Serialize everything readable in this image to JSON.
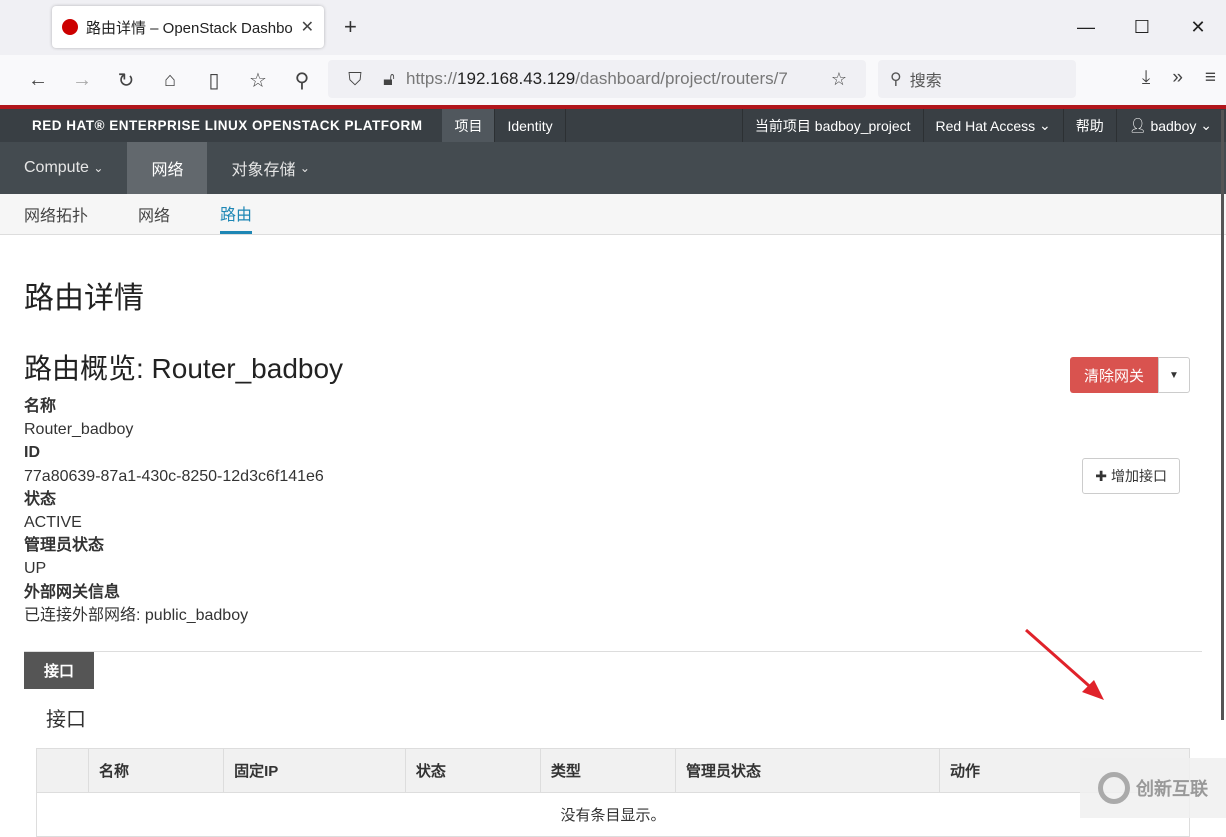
{
  "browser": {
    "tab_title": "路由详情 – OpenStack Dashbo",
    "url_host": "192.168.43.129",
    "url_prefix": "https://",
    "url_path": "/dashboard/project/routers/7",
    "search_placeholder": "搜索"
  },
  "topnav": {
    "brand": "RED HAT® ENTERPRISE LINUX OPENSTACK PLATFORM",
    "project": "项目",
    "identity": "Identity",
    "current_project": "当前项目 badboy_project",
    "redhat_access": "Red Hat Access",
    "help": "帮助",
    "user": "badboy"
  },
  "mainnav": {
    "compute": "Compute",
    "network": "网络",
    "object_storage": "对象存储"
  },
  "subnav": {
    "topology": "网络拓扑",
    "networks": "网络",
    "routers": "路由"
  },
  "page": {
    "title": "路由详情",
    "overview": "路由概览: Router_badboy",
    "clear_gateway": "清除网关",
    "details": [
      {
        "label": "名称",
        "value": "Router_badboy"
      },
      {
        "label": "ID",
        "value": "77a80639-87a1-430c-8250-12d3c6f141e6"
      },
      {
        "label": "状态",
        "value": "ACTIVE"
      },
      {
        "label": "管理员状态",
        "value": "UP"
      },
      {
        "label": "外部网关信息",
        "value": "已连接外部网络: public_badboy"
      }
    ]
  },
  "interfaces": {
    "tab": "接口",
    "title": "接口",
    "add_button": "增加接口",
    "columns": [
      "名称",
      "固定IP",
      "状态",
      "类型",
      "管理员状态",
      "动作"
    ],
    "empty": "没有条目显示。"
  },
  "watermark": "创新互联"
}
